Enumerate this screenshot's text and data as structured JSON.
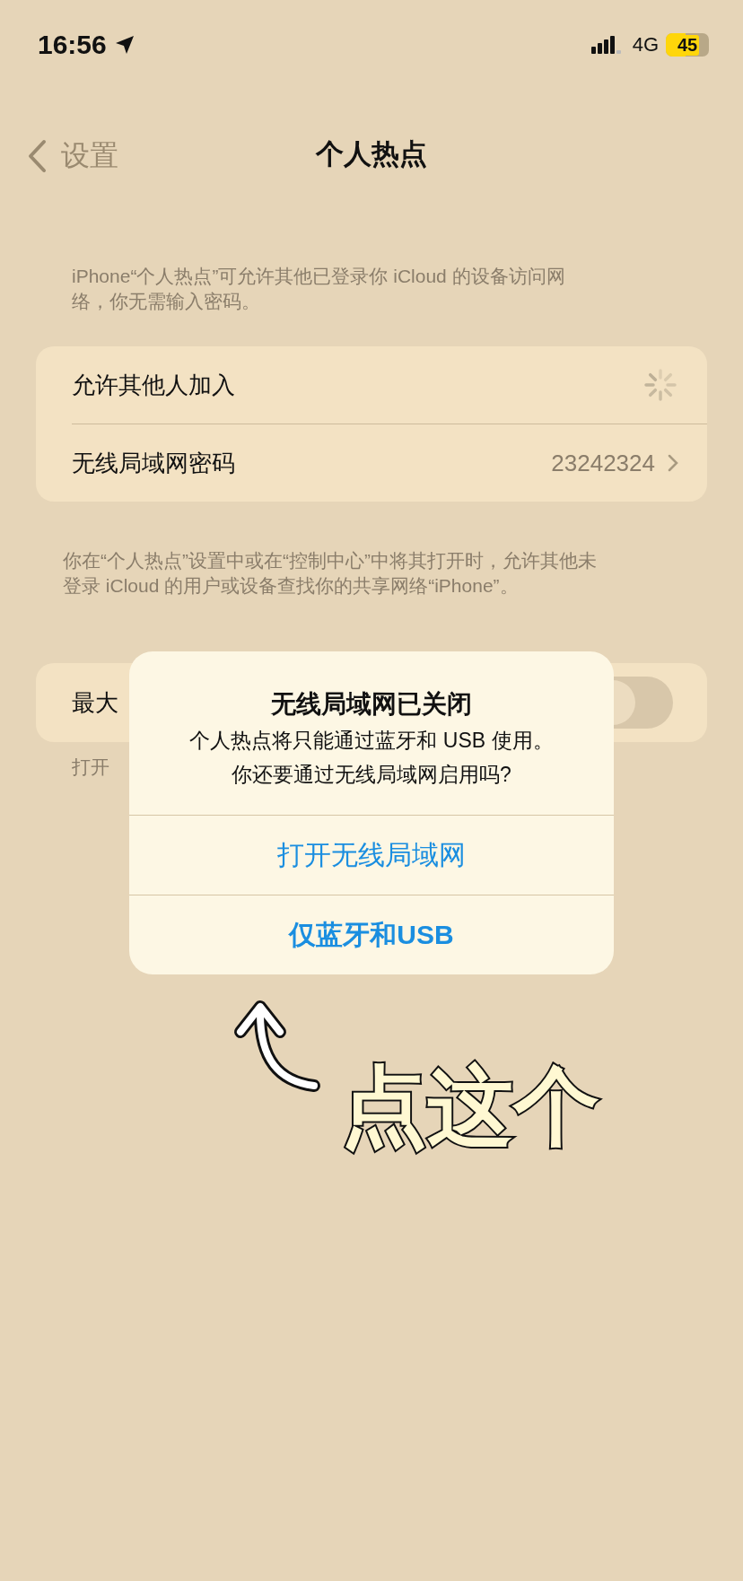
{
  "status_bar": {
    "time": "16:56",
    "network": "4G",
    "battery": "45"
  },
  "nav": {
    "back": "设置",
    "title": "个人热点"
  },
  "intro": "iPhone“个人热点”可允许其他已登录你 iCloud 的设备访问网络，你无需输入密码。",
  "settings": [
    {
      "kind": "spinner",
      "label": "允许其他人加入"
    },
    {
      "kind": "link",
      "label": "无线局域网密码",
      "value": "23242324"
    }
  ],
  "footer": "你在“个人热点”设置中或在“控制中心”中将其打开时，允许其他未登录 iCloud 的用户或设备查找你的共享网络“iPhone”。",
  "compat": {
    "label": "最大",
    "on": false,
    "note": "打开"
  },
  "alert": {
    "title": "无线局域网已关闭",
    "message": [
      "个人热点将只能通过蓝牙和 USB 使用。",
      "你还要通过无线局域网启用吗?"
    ],
    "buttons": [
      {
        "label": "打开无线局域网",
        "bold": false
      },
      {
        "label": "仅蓝牙和USB",
        "bold": true
      }
    ]
  },
  "annotation": {
    "text": "点这个"
  }
}
